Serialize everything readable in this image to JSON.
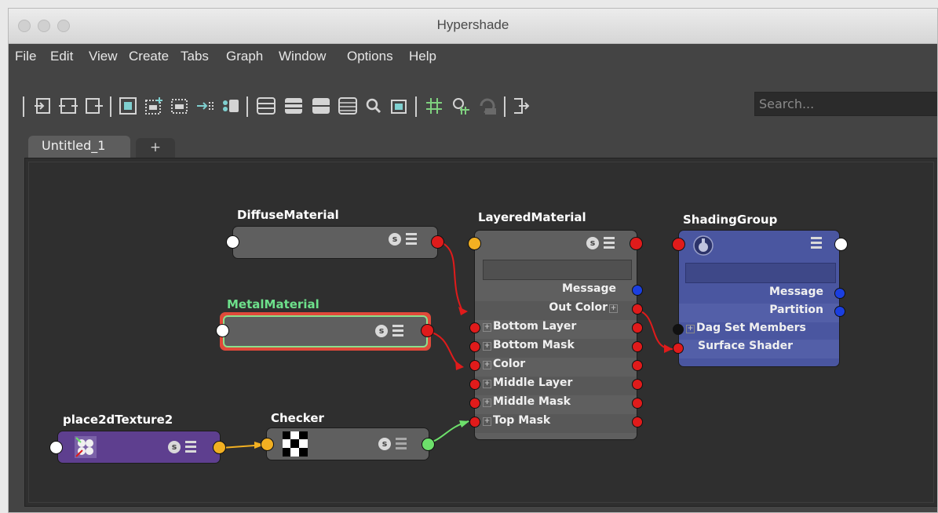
{
  "window": {
    "title": "Hypershade"
  },
  "menu": [
    "File",
    "Edit",
    "View",
    "Create",
    "Tabs",
    "Graph",
    "Window",
    "Options",
    "Help"
  ],
  "toolbar": {
    "icons": [
      "import-icon",
      "graph-materials-icon",
      "add-selected-icon",
      "frame-all-icon",
      "clear-graph-icon",
      "remove-selected-icon",
      "graph-upstream-icon",
      "graph-downstream-icon",
      "layout-simple-icon",
      "layout-connected-icon",
      "layout-all-icon",
      "layout-custom-icon",
      "search-magnify-icon",
      "toggle-swatch-icon",
      "grid-icon",
      "snap-grid-icon",
      "reload-icon",
      "toggle-attributes-icon"
    ],
    "search_placeholder": "Search..."
  },
  "tabs": {
    "active": "Untitled_1",
    "add": "+"
  },
  "nodes": {
    "diffuse": {
      "title": "DiffuseMaterial"
    },
    "metal": {
      "title": "MetalMaterial"
    },
    "layered": {
      "title": "LayeredMaterial",
      "outputs": [
        "Message",
        "Out Color"
      ],
      "inputs": [
        "Bottom Layer",
        "Bottom Mask",
        "Color",
        "Middle Layer",
        "Middle Mask",
        "Top Mask"
      ]
    },
    "shading": {
      "title": "ShadingGroup",
      "outputs": [
        "Message",
        "Partition"
      ],
      "inputs": [
        "Dag Set Members",
        "Surface Shader"
      ]
    },
    "place2d": {
      "title": "place2dTexture2"
    },
    "checker": {
      "title": "Checker"
    }
  },
  "colors": {
    "port_red": "#e01b1b",
    "port_yellow": "#f2b022",
    "port_blue": "#1b3fe0",
    "port_green": "#6de06b",
    "shading_group_bg": "#4a56a0",
    "texture_bg": "#5e3f8f",
    "selected_outline": "#e04a3a",
    "selected_inner": "#8be08c"
  }
}
